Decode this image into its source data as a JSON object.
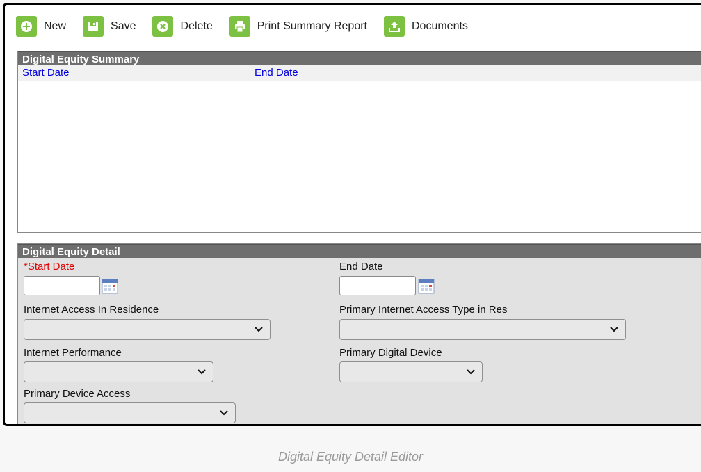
{
  "toolbar": {
    "new_label": "New",
    "save_label": "Save",
    "delete_label": "Delete",
    "print_label": "Print Summary Report",
    "documents_label": "Documents"
  },
  "summary": {
    "title": "Digital Equity Summary",
    "columns": [
      "Start Date",
      "End Date"
    ]
  },
  "detail": {
    "title": "Digital Equity Detail",
    "start_date_label": "*Start Date",
    "end_date_label": "End Date",
    "internet_access_label": "Internet Access In Residence",
    "primary_internet_type_label": "Primary Internet Access Type in Res",
    "internet_performance_label": "Internet Performance",
    "primary_device_label": "Primary Digital Device",
    "device_access_label": "Primary Device Access",
    "start_date_value": "",
    "end_date_value": ""
  },
  "caption": "Digital Equity Detail Editor",
  "colors": {
    "toolbar_icon_bg": "#7cc142",
    "panel_header_bg": "#6e6e6e",
    "required_label": "#e00000",
    "column_header_text": "#0000e0"
  }
}
